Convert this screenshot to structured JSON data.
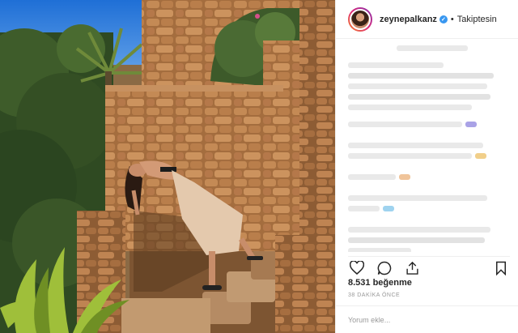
{
  "post": {
    "image_alt": "Woman in a beige skirt leaning back on old stone stairs in the sun",
    "username": "zeynepalkanz",
    "verified_icon": "verified-badge-icon",
    "separator": "•",
    "follow_status": "Takiptesin"
  },
  "actions": {
    "like_icon": "heart-icon",
    "comment_icon": "comment-icon",
    "share_icon": "share-icon",
    "save_icon": "bookmark-icon"
  },
  "stats": {
    "likes": "8.531 beğenme",
    "time": "38 DAKİKA ÖNCE"
  },
  "comment_input": {
    "placeholder": "Yorum ekle..."
  },
  "colors": {
    "verified": "#3897f0",
    "border": "#efefef",
    "muted": "#999999",
    "sky": "#2f7ad9",
    "stone": "#b07a47"
  }
}
